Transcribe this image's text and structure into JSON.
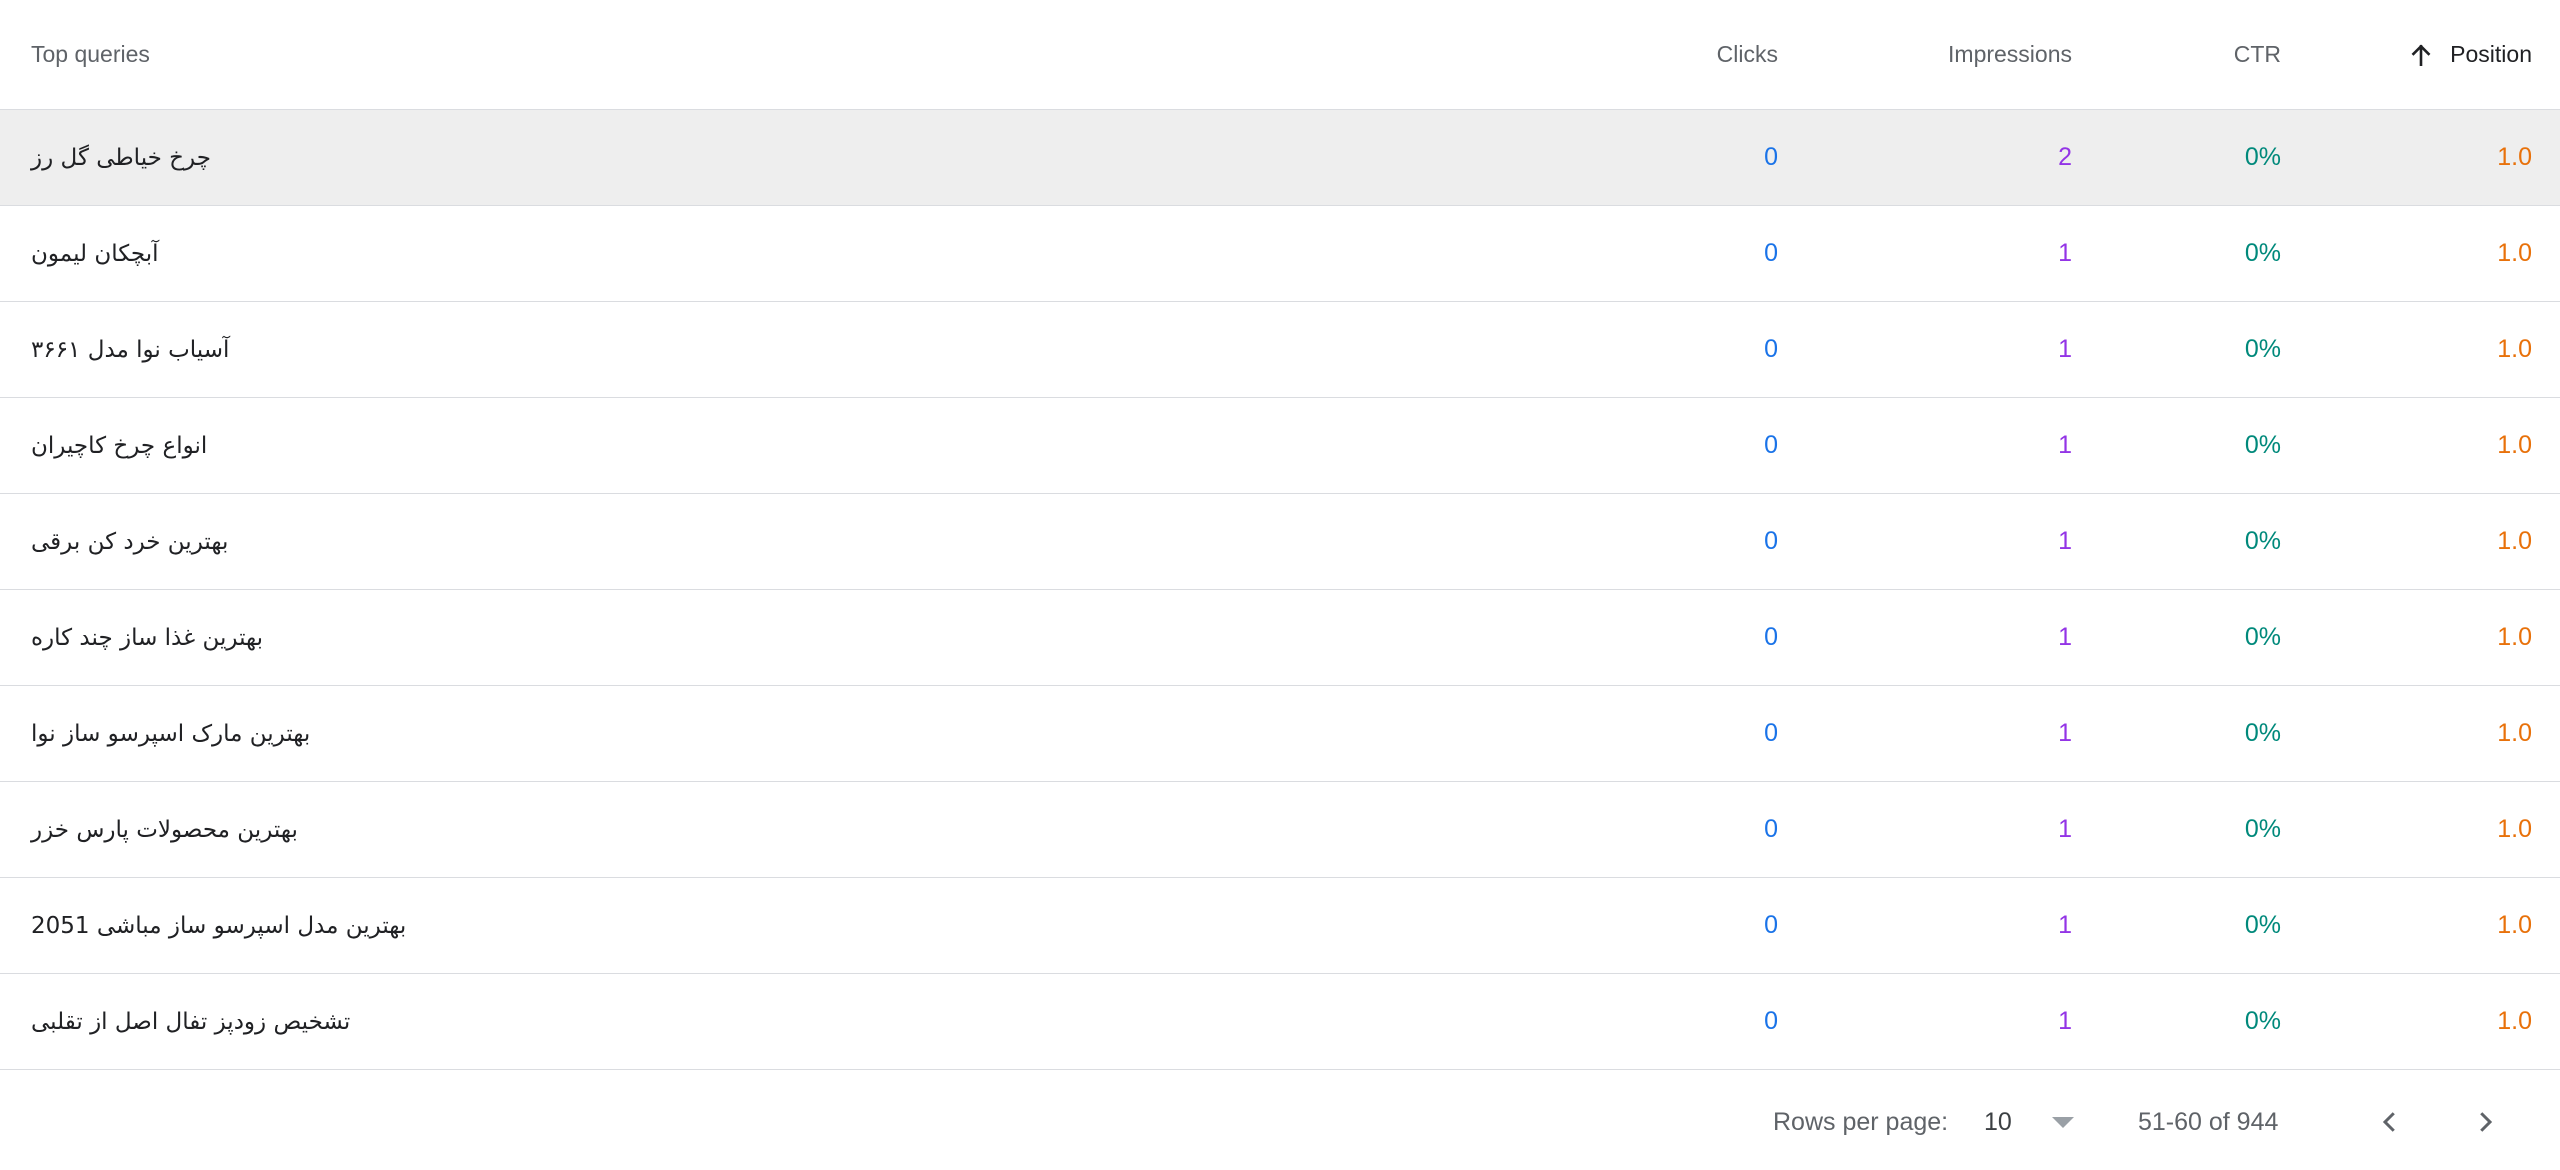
{
  "header": {
    "query": "Top queries",
    "clicks": "Clicks",
    "impressions": "Impressions",
    "ctr": "CTR",
    "position": "Position",
    "sort_icon": "arrow-up-icon"
  },
  "rows": [
    {
      "query": "چرخ خیاطی گل رز",
      "clicks": "0",
      "impressions": "2",
      "ctr": "0%",
      "position": "1.0"
    },
    {
      "query": "آبچکان لیمون",
      "clicks": "0",
      "impressions": "1",
      "ctr": "0%",
      "position": "1.0"
    },
    {
      "query": "آسیاب نوا مدل ۳۶۶۱",
      "clicks": "0",
      "impressions": "1",
      "ctr": "0%",
      "position": "1.0"
    },
    {
      "query": "انواع چرخ کاچیران",
      "clicks": "0",
      "impressions": "1",
      "ctr": "0%",
      "position": "1.0"
    },
    {
      "query": "بهترین خرد کن برقی",
      "clicks": "0",
      "impressions": "1",
      "ctr": "0%",
      "position": "1.0"
    },
    {
      "query": "بهترین غذا ساز چند کاره",
      "clicks": "0",
      "impressions": "1",
      "ctr": "0%",
      "position": "1.0"
    },
    {
      "query": "بهترین مارک اسپرسو ساز نوا",
      "clicks": "0",
      "impressions": "1",
      "ctr": "0%",
      "position": "1.0"
    },
    {
      "query": "بهترین محصولات پارس خزر",
      "clicks": "0",
      "impressions": "1",
      "ctr": "0%",
      "position": "1.0"
    },
    {
      "query": "بهترین مدل اسپرسو ساز مباشی 2051",
      "clicks": "0",
      "impressions": "1",
      "ctr": "0%",
      "position": "1.0"
    },
    {
      "query": "تشخیص زودپز تفال اصل از تقلبی",
      "clicks": "0",
      "impressions": "1",
      "ctr": "0%",
      "position": "1.0"
    }
  ],
  "footer": {
    "rows_per_page_label": "Rows per page:",
    "rows_per_page_value": "10",
    "range_text": "51-60 of 944",
    "prev_icon": "chevron-left-icon",
    "next_icon": "chevron-right-icon"
  },
  "colors": {
    "clicks": "#1a73e8",
    "impressions": "#9334e6",
    "ctr": "#00897b",
    "position": "#e8710a",
    "highlight_row": "#eeeeee"
  }
}
